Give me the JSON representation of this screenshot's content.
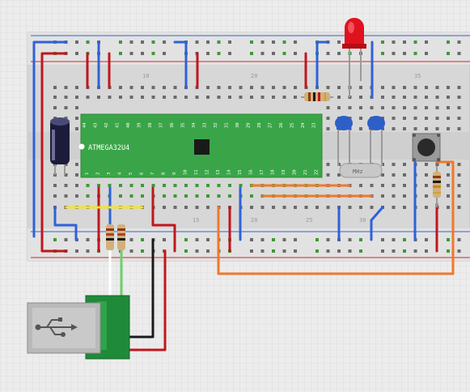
{
  "chip": {
    "name": "ATMEGA32U4",
    "top_pins": [
      "44",
      "43",
      "42",
      "41",
      "40",
      "39",
      "38",
      "37",
      "36",
      "35",
      "34",
      "33",
      "32",
      "31",
      "30",
      "29",
      "28",
      "27",
      "26",
      "25",
      "24",
      "23"
    ],
    "bottom_pins": [
      "1",
      "2",
      "3",
      "4",
      "5",
      "6",
      "7",
      "8",
      "9",
      "10",
      "11",
      "12",
      "13",
      "14",
      "15",
      "16",
      "17",
      "18",
      "19",
      "20",
      "21",
      "22"
    ]
  },
  "crystal": {
    "label": "MHz"
  },
  "breadboard": {
    "column_labels": [
      "10",
      "20",
      "35",
      "15",
      "20",
      "25",
      "30"
    ]
  },
  "components": [
    {
      "kind": "led",
      "color": "#e0121e"
    },
    {
      "kind": "electrolytic-capacitor"
    },
    {
      "kind": "ceramic-capacitor"
    },
    {
      "kind": "ceramic-capacitor"
    },
    {
      "kind": "pushbutton"
    },
    {
      "kind": "usb-connector",
      "icon": "usb-icon"
    }
  ],
  "colors": {
    "board": "#d9d9d9",
    "rail_red": "#d4262b",
    "rail_blue": "#3561c9",
    "chip": "#3aa548",
    "wire_blue": "#2e62d8",
    "wire_red": "#c0161e",
    "wire_orange": "#f0782a",
    "wire_yellow": "#f5e428",
    "wire_black": "#1a1a1a",
    "hole": "#3c9a35"
  }
}
